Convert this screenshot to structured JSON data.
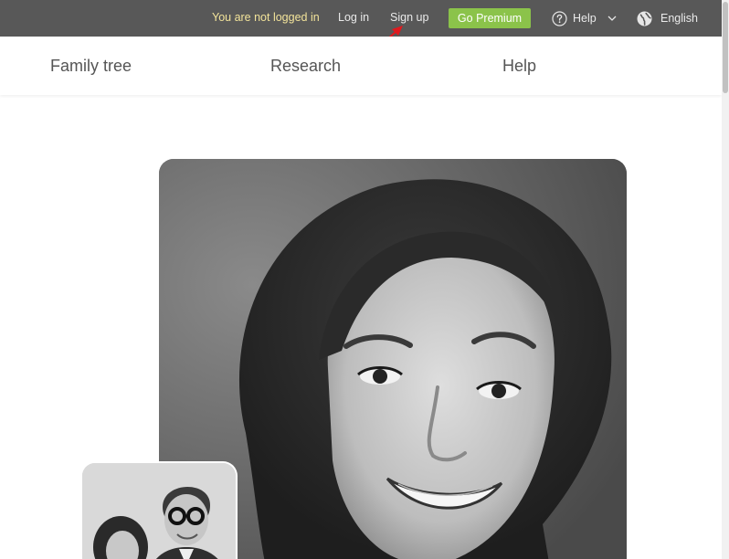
{
  "topbar": {
    "status_text": "You are not logged in",
    "login_label": "Log in",
    "signup_label": "Sign up",
    "premium_label": "Go Premium",
    "help_label": "Help",
    "language_label": "English",
    "help_icon": "question-circle-icon",
    "chevron_icon": "chevron-down-icon",
    "language_icon": "globe-icon"
  },
  "nav": {
    "items": [
      {
        "label": "Family tree"
      },
      {
        "label": "Research"
      },
      {
        "label": "Help"
      }
    ]
  },
  "hero": {
    "main_photo": "black-and-white portrait of smiling woman",
    "inset_photo": "black-and-white photo of couple"
  },
  "colors": {
    "topbar_bg": "#585858",
    "status_text": "#f2e39a",
    "premium_bg": "#8bc34a",
    "annotation_arrow": "#e0191e"
  }
}
